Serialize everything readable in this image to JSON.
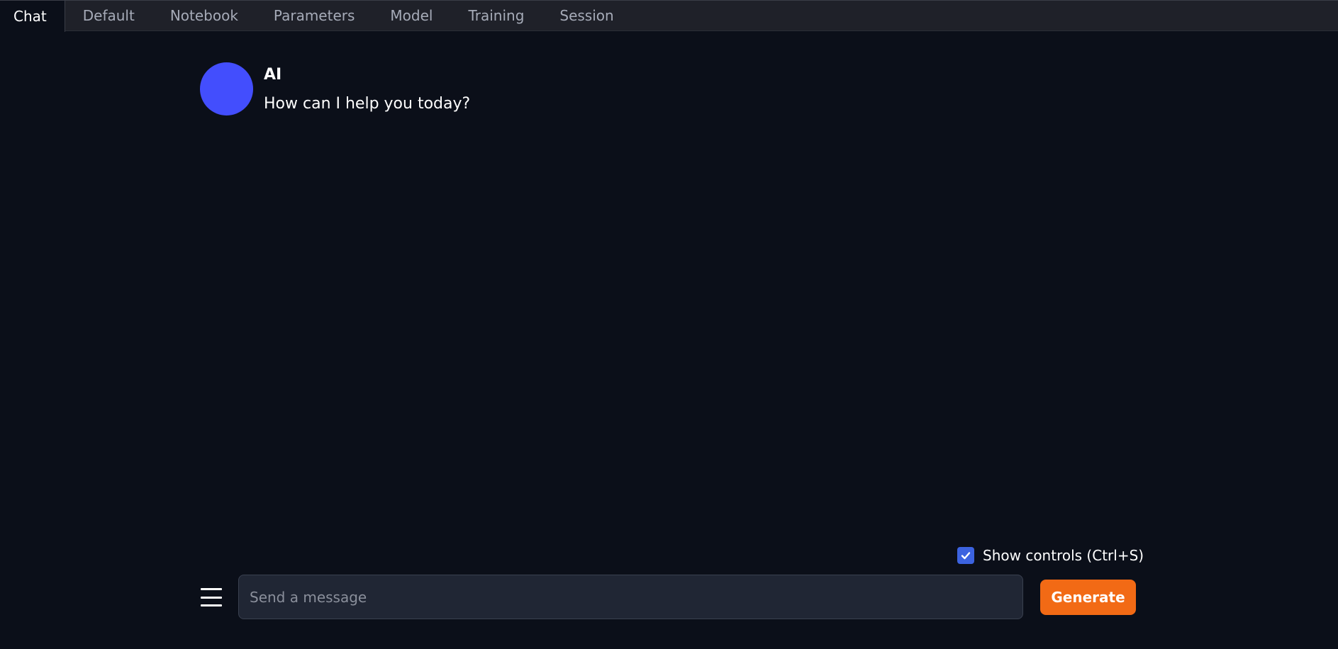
{
  "tabs": [
    {
      "label": "Chat",
      "active": true
    },
    {
      "label": "Default",
      "active": false
    },
    {
      "label": "Notebook",
      "active": false
    },
    {
      "label": "Parameters",
      "active": false
    },
    {
      "label": "Model",
      "active": false
    },
    {
      "label": "Training",
      "active": false
    },
    {
      "label": "Session",
      "active": false
    }
  ],
  "chat": {
    "messages": [
      {
        "author": "AI",
        "text": "How can I help you today?",
        "avatar_color": "#434efd"
      }
    ]
  },
  "controls": {
    "show_controls_label": "Show controls (Ctrl+S)",
    "show_controls_checked": true
  },
  "input": {
    "placeholder": "Send a message",
    "value": ""
  },
  "actions": {
    "generate_label": "Generate"
  },
  "icons": {
    "menu": "hamburger-menu-icon",
    "check": "checkmark-icon"
  },
  "colors": {
    "background": "#0b0f19",
    "tabbar": "#1f2129",
    "accent": "#f26a15",
    "checkbox": "#3c63e0",
    "avatar": "#434efd"
  }
}
